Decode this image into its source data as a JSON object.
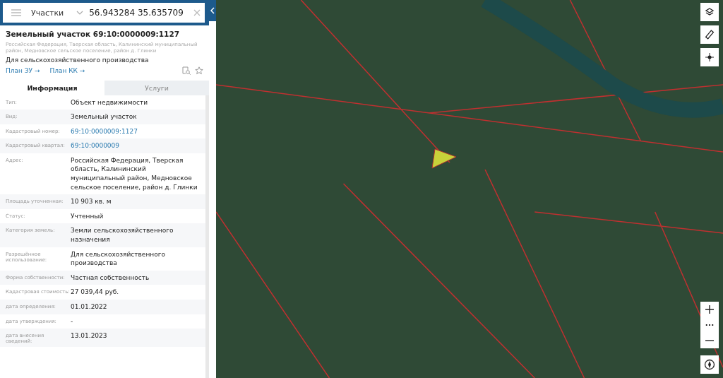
{
  "search": {
    "layer": "Участки",
    "value": "56.943284 35.635709"
  },
  "card": {
    "title": "Земельный участок 69:10:0000009:1127",
    "address": "Российская Федерация, Тверская область, Калининский муниципальный район, Медновское сельское поселение, район д. Глинки",
    "purpose": "Для сельскохозяйственного производства",
    "links": [
      "План ЗУ →",
      "План КК →"
    ]
  },
  "tabs": [
    {
      "label": "Информация",
      "selected": true
    },
    {
      "label": "Услуги",
      "selected": false
    }
  ],
  "fields": [
    {
      "label": "Тип:",
      "value": "Объект недвижимости",
      "kind": "text"
    },
    {
      "label": "Вид:",
      "value": "Земельный участок",
      "kind": "text"
    },
    {
      "label": "Кадастровый номер:",
      "value": "69:10:0000009:1127",
      "kind": "link"
    },
    {
      "label": "Кадастровый квартал:",
      "value": "69:10:0000009",
      "kind": "link"
    },
    {
      "label": "Адрес:",
      "value": "Российская Федерация, Тверская область, Калининский муниципальный район, Медновское сельское поселение, район д. Глинки",
      "kind": "text"
    },
    {
      "label": "Площадь уточненная:",
      "value": "10 903 кв. м",
      "kind": "text"
    },
    {
      "label": "Статус:",
      "value": "Учтенный",
      "kind": "text"
    },
    {
      "label": "Категория земель:",
      "value": "Земли сельскохозяйственного назначения",
      "kind": "text"
    },
    {
      "label": "Разрешённое использование:",
      "value": "Для сельскохозяйственного производства",
      "kind": "text"
    },
    {
      "label": "Форма собственности:",
      "value": "Частная собственность",
      "kind": "text"
    },
    {
      "label": "Кадастровая стоимость:",
      "value": "27 039,44 руб.",
      "kind": "text"
    },
    {
      "label": "дата определения:",
      "value": "01.01.2022",
      "kind": "text"
    },
    {
      "label": "дата утверждения:",
      "value": "-",
      "kind": "text"
    },
    {
      "label": "дата внесения сведений:",
      "value": "13.01.2023",
      "kind": "text"
    }
  ]
}
